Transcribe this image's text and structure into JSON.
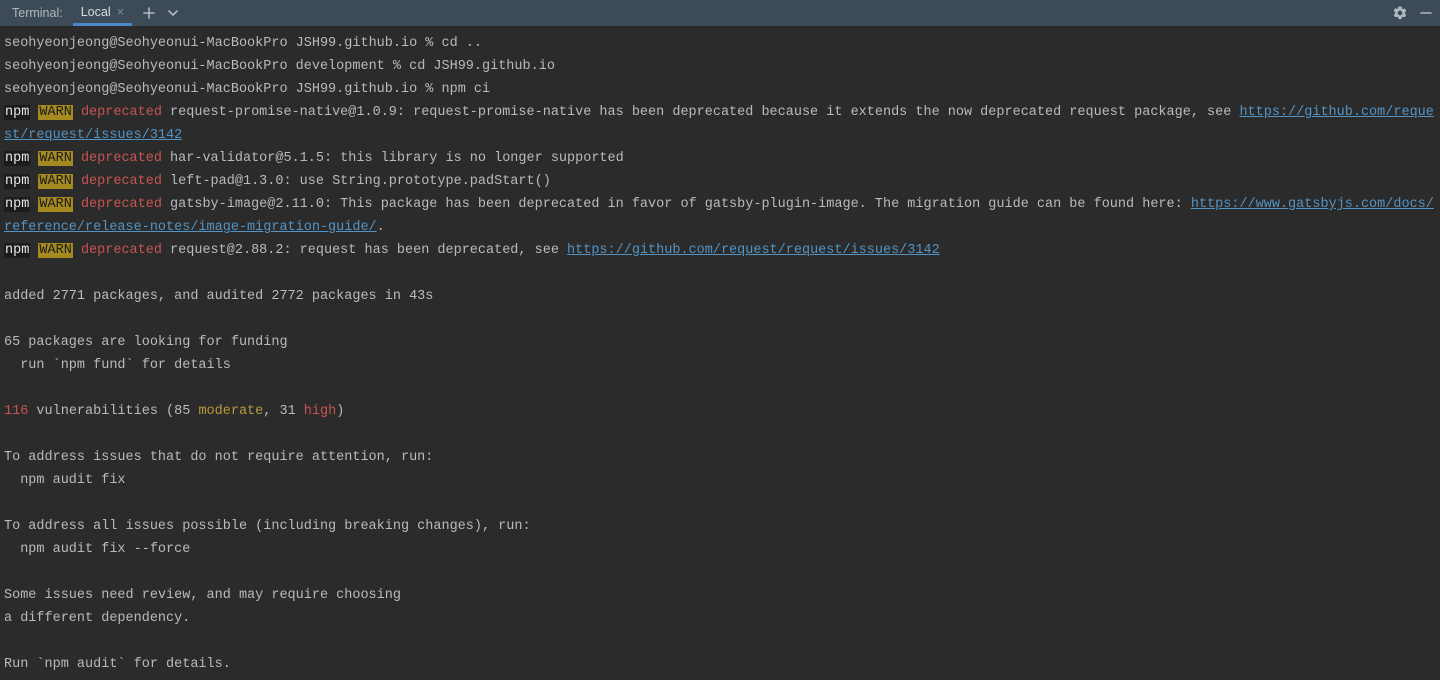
{
  "titlebar": {
    "label": "Terminal:",
    "tab": "Local",
    "close_glyph": "×",
    "plus_glyph": "+",
    "chevron_glyph": "⌄"
  },
  "prompt": {
    "user_host": "seohyeonjeong@Seohyeonui-MacBookPro",
    "dir1": "JSH99.github.io",
    "dir2": "development",
    "sep": " % "
  },
  "cmd": {
    "cd_up": "cd ..",
    "cd_repo": "cd JSH99.github.io",
    "npm_ci": "npm ci"
  },
  "tags": {
    "npm": "npm",
    "warn": "WARN",
    "deprecated": "deprecated"
  },
  "warn1": {
    "text_a": " request-promise-native@1.0.9: request-promise-native has been deprecated because it extends the now deprecated request package, see ",
    "link": "https://github.com/request/request/issues/3142"
  },
  "warn2": {
    "text": " har-validator@5.1.5: this library is no longer supported"
  },
  "warn3": {
    "text": " left-pad@1.3.0: use String.prototype.padStart()"
  },
  "warn4": {
    "text_a": " gatsby-image@2.11.0: This package has been deprecated in favor of gatsby-plugin-image. The migration guide can be found here: ",
    "link": "https://www.gatsbyjs.com/docs/reference/release-notes/image-migration-guide/",
    "text_b": "."
  },
  "warn5": {
    "text_a": " request@2.88.2: request has been deprecated, see ",
    "link": "https://github.com/request/request/issues/3142"
  },
  "summary": {
    "added": "added 2771 packages, and audited 2772 packages in 43s",
    "funding1": "65 packages are looking for funding",
    "funding2": "  run `npm fund` for details",
    "vuln_count": "116",
    "vuln_mid_a": " vulnerabilities (85 ",
    "moderate": "moderate",
    "vuln_mid_b": ", 31 ",
    "high": "high",
    "vuln_end": ")",
    "addr1": "To address issues that do not require attention, run:",
    "addr1_cmd": "  npm audit fix",
    "addr2": "To address all issues possible (including breaking changes), run:",
    "addr2_cmd": "  npm audit fix --force",
    "review1": "Some issues need review, and may require choosing",
    "review2": "a different dependency.",
    "audit": "Run `npm audit` for details."
  }
}
